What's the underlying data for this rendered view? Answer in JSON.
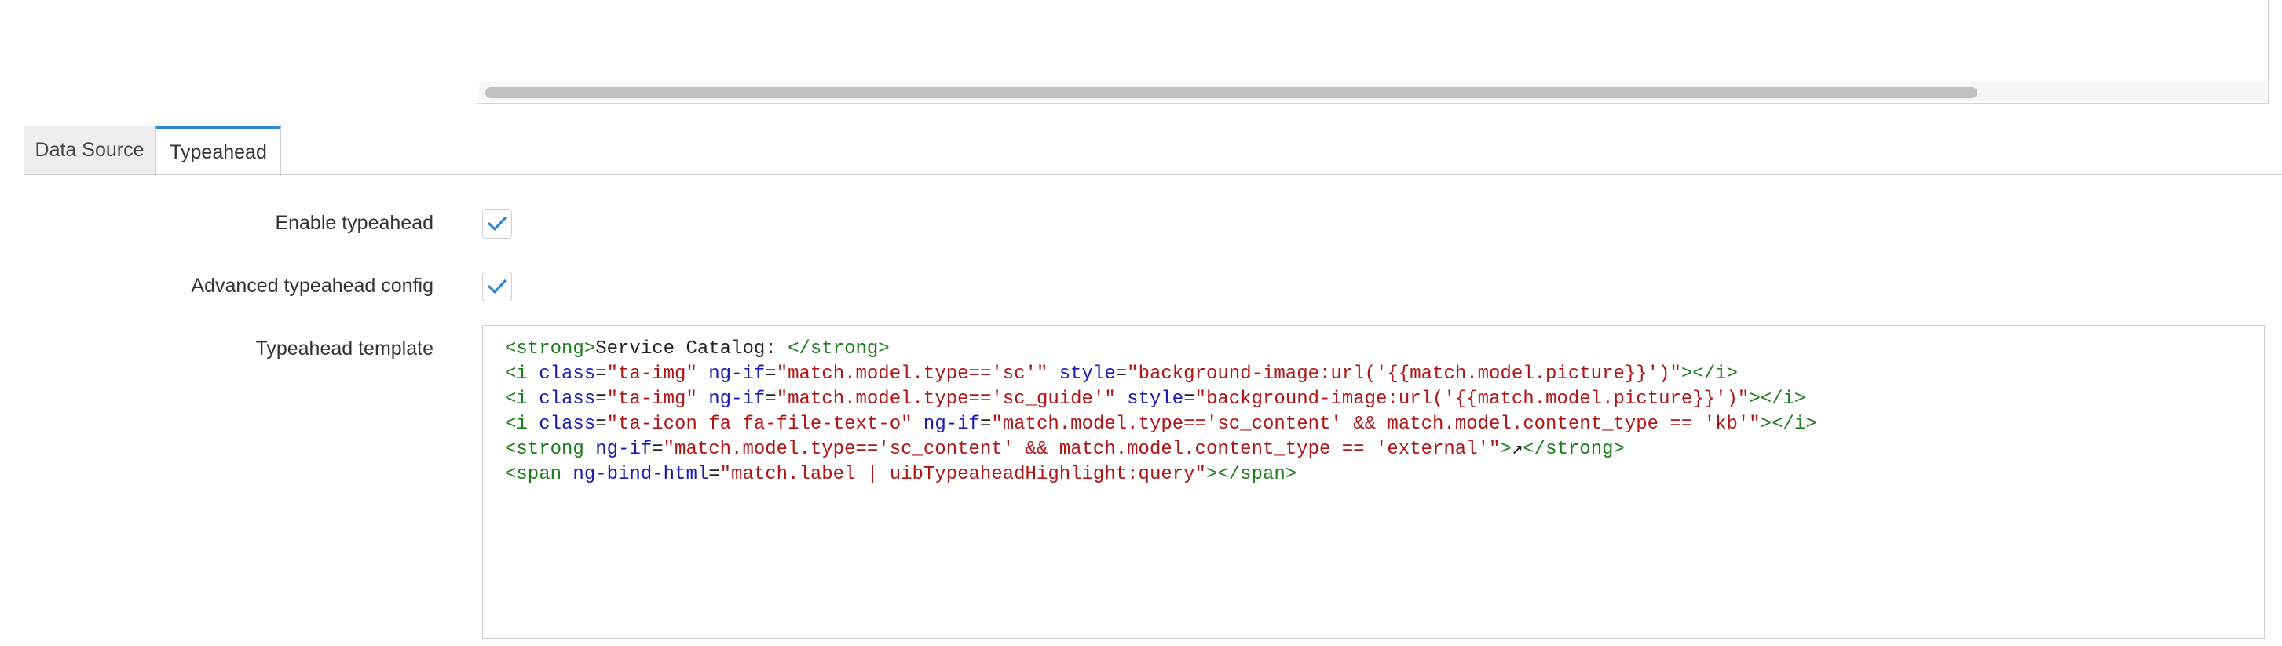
{
  "tabs": [
    {
      "label": "Data Source",
      "active": false
    },
    {
      "label": "Typeahead",
      "active": true
    }
  ],
  "accent_color": "#2a8bd8",
  "fields": {
    "enable_typeahead": {
      "label": "Enable typeahead",
      "checked": true
    },
    "advanced_config": {
      "label": "Advanced typeahead config",
      "checked": true
    },
    "template": {
      "label": "Typeahead template"
    }
  },
  "template_code": {
    "line1": {
      "open": "<strong>",
      "text": "Service Catalog: ",
      "close": "</strong>"
    },
    "line2": {
      "t1": "<i ",
      "a1": "class",
      "eq1": "=",
      "s1": "\"ta-img\"",
      "a2": " ng-if",
      "eq2": "=",
      "s2": "\"match.model.type=='sc'\"",
      "a3": " style",
      "eq3": "=",
      "s3": "\"background-image:url('{{match.model.picture}}')\"",
      "t2": "></i>"
    },
    "line3": {
      "t1": "<i ",
      "a1": "class",
      "eq1": "=",
      "s1": "\"ta-img\"",
      "a2": " ng-if",
      "eq2": "=",
      "s2": "\"match.model.type=='sc_guide'\"",
      "a3": " style",
      "eq3": "=",
      "s3": "\"background-image:url('{{match.model.picture}}')\"",
      "t2": "></i>"
    },
    "line4": {
      "t1": "<i ",
      "a1": "class",
      "eq1": "=",
      "s1": "\"ta-icon fa fa-file-text-o\"",
      "a2": " ng-if",
      "eq2": "=",
      "s2": "\"match.model.type=='sc_content' && match.model.content_type == 'kb'\"",
      "t2": "></i>"
    },
    "line5": {
      "t1": "<strong ",
      "a1": "ng-if",
      "eq1": "=",
      "s1": "\"match.model.type=='sc_content' && match.model.content_type == 'external'\"",
      "t2": ">",
      "p1": "↗",
      "t3": "</strong>"
    },
    "line6": {
      "t1": "<span ",
      "a1": "ng-bind-html",
      "eq1": "=",
      "s1": "\"match.label | uibTypeaheadHighlight:query\"",
      "t2": "></span>"
    }
  }
}
